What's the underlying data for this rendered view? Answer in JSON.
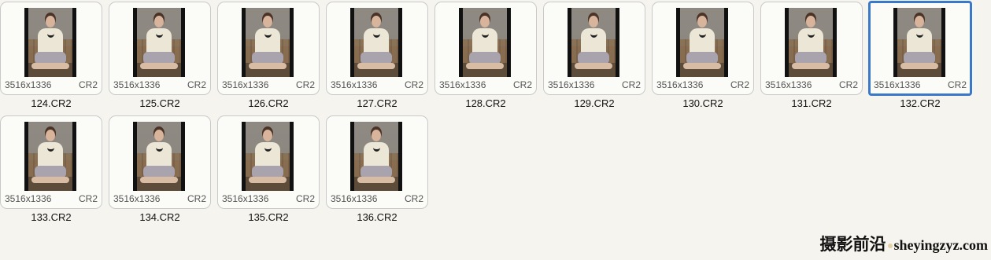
{
  "files": [
    {
      "name": "124.CR2",
      "dims": "3516x1336",
      "ext": "CR2",
      "selected": false
    },
    {
      "name": "125.CR2",
      "dims": "3516x1336",
      "ext": "CR2",
      "selected": false
    },
    {
      "name": "126.CR2",
      "dims": "3516x1336",
      "ext": "CR2",
      "selected": false
    },
    {
      "name": "127.CR2",
      "dims": "3516x1336",
      "ext": "CR2",
      "selected": false
    },
    {
      "name": "128.CR2",
      "dims": "3516x1336",
      "ext": "CR2",
      "selected": false
    },
    {
      "name": "129.CR2",
      "dims": "3516x1336",
      "ext": "CR2",
      "selected": false
    },
    {
      "name": "130.CR2",
      "dims": "3516x1336",
      "ext": "CR2",
      "selected": false
    },
    {
      "name": "131.CR2",
      "dims": "3516x1336",
      "ext": "CR2",
      "selected": false
    },
    {
      "name": "132.CR2",
      "dims": "3516x1336",
      "ext": "CR2",
      "selected": true
    },
    {
      "name": "133.CR2",
      "dims": "3516x1336",
      "ext": "CR2",
      "selected": false
    },
    {
      "name": "134.CR2",
      "dims": "3516x1336",
      "ext": "CR2",
      "selected": false
    },
    {
      "name": "135.CR2",
      "dims": "3516x1336",
      "ext": "CR2",
      "selected": false
    },
    {
      "name": "136.CR2",
      "dims": "3516x1336",
      "ext": "CR2",
      "selected": false
    }
  ],
  "watermark": {
    "cn": "摄影前沿",
    "site": "sheyingzyz.com"
  },
  "colors": {
    "selection": "#3a78c9",
    "background": "#f5f4ee"
  }
}
